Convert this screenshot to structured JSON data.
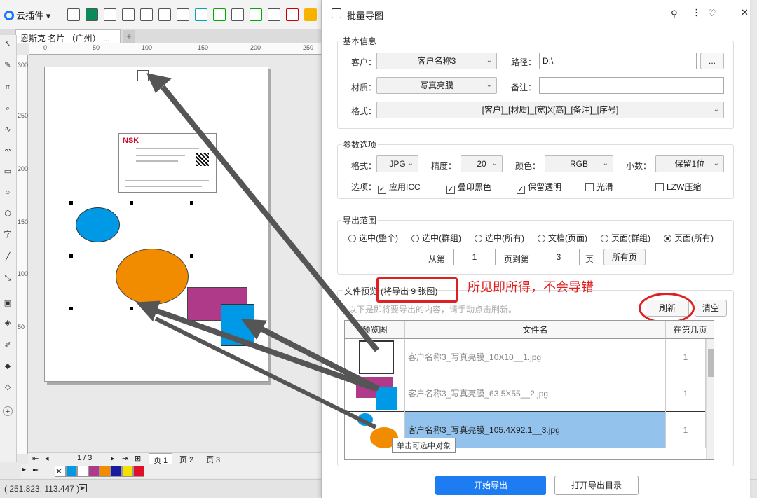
{
  "app": {
    "plugin_menu": "云插件",
    "doc_tab": "恩斯克 名片 （广州） ...",
    "card_logo": "NSK",
    "page_nav": "1 / 3",
    "pages": [
      "页 1",
      "页 2",
      "页 3"
    ],
    "status_coords": "( 251.823, 113.447 )",
    "ruler_h": [
      "0",
      "50",
      "100",
      "150",
      "200",
      "250"
    ],
    "ruler_v": [
      "300",
      "250",
      "200",
      "150",
      "100",
      "50"
    ],
    "palette": [
      "#ffffff",
      "#0099e5",
      "#ffffff",
      "#b03a8a",
      "#f18c00",
      "#1a1aa0",
      "#f5e000",
      "#e0102a"
    ]
  },
  "dialog": {
    "title": "批量导图",
    "basic": {
      "label": "基本信息",
      "customer_label": "客户：",
      "customer_value": "客户名称3",
      "path_label": "路径：",
      "path_value": "D:\\",
      "browse": "...",
      "material_label": "材质：",
      "material_value": "写真亮膜",
      "note_label": "备注：",
      "note_value": "",
      "format_label": "格式：",
      "format_value": "[客户]_[材质]_[宽]X[高]_[备注]_[序号]"
    },
    "params": {
      "label": "参数选项",
      "format_label": "格式：",
      "format_value": "JPG",
      "precision_label": "精度：",
      "precision_value": "20",
      "color_label": "颜色：",
      "color_value": "RGB",
      "decimal_label": "小数：",
      "decimal_value": "保留1位",
      "options_label": "选项：",
      "options": [
        {
          "label": "应用ICC",
          "checked": true
        },
        {
          "label": "叠印黑色",
          "checked": true
        },
        {
          "label": "保留透明",
          "checked": true
        },
        {
          "label": "光滑",
          "checked": false
        },
        {
          "label": "LZW压缩",
          "checked": false
        }
      ]
    },
    "range": {
      "label": "导出范围",
      "radios": [
        {
          "label": "选中(整个)",
          "selected": false
        },
        {
          "label": "选中(群组)",
          "selected": false
        },
        {
          "label": "选中(所有)",
          "selected": false
        },
        {
          "label": "文档(页面)",
          "selected": false
        },
        {
          "label": "页面(群组)",
          "selected": false
        },
        {
          "label": "页面(所有)",
          "selected": true
        }
      ],
      "from_label": "从第",
      "from_value": "1",
      "to_label": "页到第",
      "to_value": "3",
      "page_unit": "页",
      "all_pages": "所有页"
    },
    "preview": {
      "label": "文件预览",
      "count": "(将导出 9 张图)",
      "hint": "以下是即将要导出的内容，请手动点击刷新。",
      "refresh": "刷新",
      "clear": "清空",
      "columns": [
        "预览图",
        "文件名",
        "在第几页"
      ],
      "rows": [
        {
          "filename": "客户名称3_写真亮膜_10X10__1.jpg",
          "page": "1"
        },
        {
          "filename": "客户名称3_写真亮膜_63.5X55__2.jpg",
          "page": "1"
        },
        {
          "filename": "客户名称3_写真亮膜_105.4X92.1__3.jpg",
          "page": "1"
        }
      ],
      "tooltip": "单击可选中对象"
    },
    "start": "开始导出",
    "open_dir": "打开导出目录",
    "annotation": "所见即所得，不会导错",
    "accent": "#1e7cf2",
    "annotation_color": "#e02020"
  }
}
